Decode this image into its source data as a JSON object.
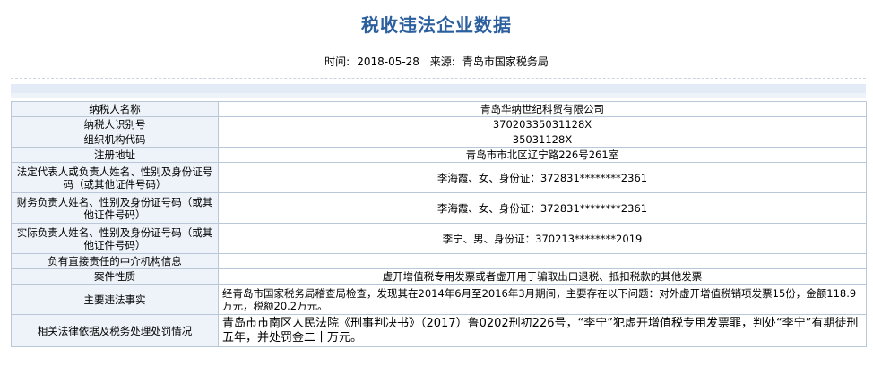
{
  "header": {
    "title": "税收违法企业数据",
    "time_label": "时间:",
    "time_value": "2018-05-28",
    "source_label": "来源:",
    "source_value": "青岛市国家税务局"
  },
  "rows": [
    {
      "label": "纳税人名称",
      "value": "青岛华纳世纪科贸有限公司"
    },
    {
      "label": "纳税人识别号",
      "value": "37020335031128X"
    },
    {
      "label": "组织机构代码",
      "value": "35031128X"
    },
    {
      "label": "注册地址",
      "value": "青岛市市北区辽宁路226号261室"
    },
    {
      "label": "法定代表人或负责人姓名、性别及身份证号码（或其他证件号码）",
      "value": "李海霞、女、身份证：372831********2361"
    },
    {
      "label": "财务负责人姓名、性别及身份证号码（或其他证件号码）",
      "value": "李海霞、女、身份证：372831********2361"
    },
    {
      "label": "实际负责人姓名、性别及身份证号码（或其他证件号码）",
      "value": "李宁、男、身份证：370213********2019"
    },
    {
      "label": "负有直接责任的中介机构信息",
      "value": ""
    },
    {
      "label": "案件性质",
      "value": "虚开增值税专用发票或者虚开用于骗取出口退税、抵扣税款的其他发票"
    },
    {
      "label": "主要违法事实",
      "value": "经青岛市国家税务局稽查局检查，发现其在2014年6月至2016年3月期间，主要存在以下问题：对外虚开增值税销项发票15份，金额118.9万元，税额20.2万元。"
    },
    {
      "label": "相关法律依据及税务处理处罚情况",
      "value": "青岛市市南区人民法院《刑事判决书》（2017）鲁0202刑初226号，“李宁”犯虚开增值税专用发票罪，判处“李宁”有期徒刑五年，并处罚金二十万元。"
    }
  ]
}
